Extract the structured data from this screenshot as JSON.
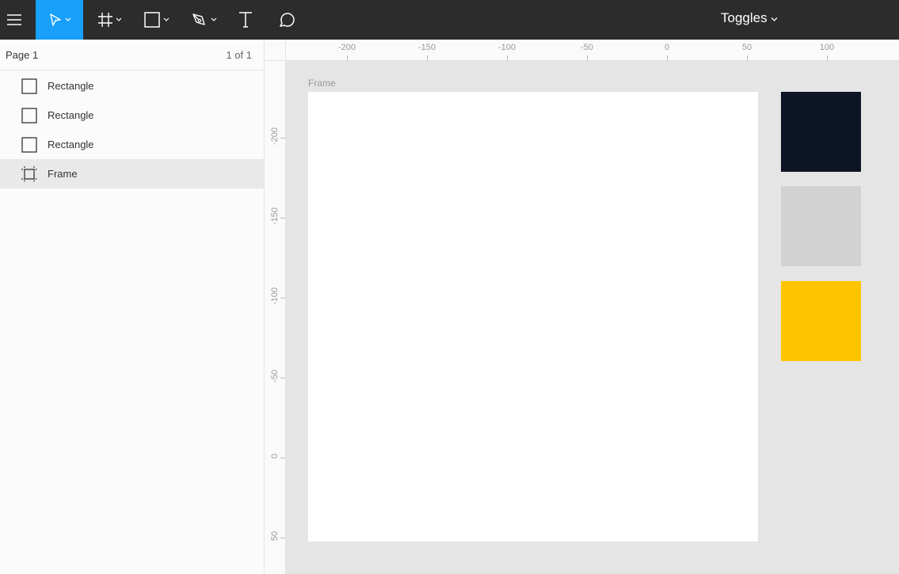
{
  "toolbar": {
    "menu_icon": "hamburger-icon",
    "tools": [
      {
        "name": "move-tool",
        "icon": "cursor-arrow-icon",
        "active": true,
        "has_dropdown": true
      },
      {
        "name": "frame-tool",
        "icon": "frame-hash-icon",
        "active": false,
        "has_dropdown": true
      },
      {
        "name": "rectangle-tool",
        "icon": "square-icon",
        "active": false,
        "has_dropdown": true
      },
      {
        "name": "pen-tool",
        "icon": "pen-icon",
        "active": false,
        "has_dropdown": true
      },
      {
        "name": "text-tool",
        "icon": "text-T-icon",
        "active": false,
        "has_dropdown": false
      },
      {
        "name": "comment-tool",
        "icon": "speech-bubble-icon",
        "active": false,
        "has_dropdown": false
      }
    ],
    "document_title": "Toggles",
    "active_color": "#18a0fb"
  },
  "pages": {
    "current": "Page 1",
    "count": "1 of 1"
  },
  "layers": [
    {
      "label": "Rectangle",
      "icon": "rectangle-layer-icon",
      "selected": false
    },
    {
      "label": "Rectangle",
      "icon": "rectangle-layer-icon",
      "selected": false
    },
    {
      "label": "Rectangle",
      "icon": "rectangle-layer-icon",
      "selected": false
    },
    {
      "label": "Frame",
      "icon": "frame-layer-icon",
      "selected": true
    }
  ],
  "rulers": {
    "top_labels": [
      "-200",
      "-150",
      "-100",
      "-50",
      "0",
      "50",
      "100"
    ],
    "left_labels": [
      "-200",
      "-150",
      "-100",
      "-50",
      "0",
      "50"
    ]
  },
  "canvas": {
    "frame_label": "Frame",
    "frame_color": "#ffffff",
    "swatches": [
      {
        "name": "dark",
        "color": "#0d1424"
      },
      {
        "name": "gray",
        "color": "#d2d2d2"
      },
      {
        "name": "yellow",
        "color": "#ffc400"
      }
    ]
  }
}
